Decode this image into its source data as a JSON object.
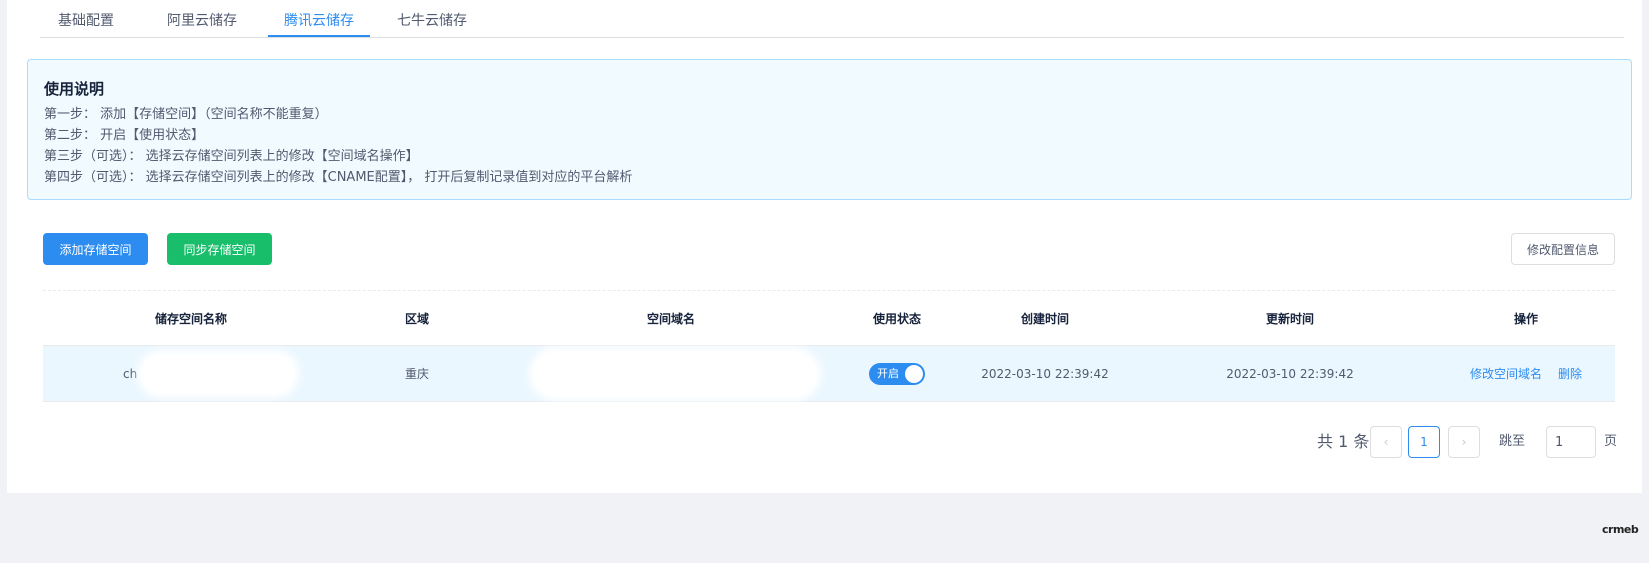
{
  "tabs": [
    {
      "label": "基础配置"
    },
    {
      "label": "阿里云储存"
    },
    {
      "label": "腾讯云储存"
    },
    {
      "label": "七牛云储存"
    }
  ],
  "active_tab": 2,
  "notice": {
    "title": "使用说明",
    "lines": [
      "第一步： 添加【存储空间】（空间名称不能重复）",
      "第二步： 开启【使用状态】",
      "第三步（可选）： 选择云存储空间列表上的修改【空间域名操作】",
      "第四步（可选）： 选择云存储空间列表上的修改【CNAME配置】， 打开后复制记录值到对应的平台解析"
    ]
  },
  "toolbar": {
    "add_label": "添加存储空间",
    "sync_label": "同步存储空间",
    "edit_config_label": "修改配置信息"
  },
  "table": {
    "columns": [
      "储存空间名称",
      "区域",
      "空间域名",
      "使用状态",
      "创建时间",
      "更新时间",
      "操作"
    ],
    "rows": [
      {
        "name": "ch",
        "region": "重庆",
        "domain": "",
        "status_label": "开启",
        "status_on": true,
        "created": "2022-03-10 22:39:42",
        "updated": "2022-03-10 22:39:42",
        "action_edit": "修改空间域名",
        "action_delete": "删除"
      }
    ]
  },
  "pagination": {
    "total_text": "共 1 条",
    "current_page": "1",
    "jump_label": "跳至",
    "jump_value": "1",
    "page_suffix": "页",
    "prev_icon": "chevron-left-icon",
    "next_icon": "chevron-right-icon"
  },
  "brand": {
    "logo_text": "crmeb"
  },
  "colors": {
    "primary": "#2d8cf0",
    "success": "#19be6b",
    "alert_bg": "#f0faff",
    "row_highlight": "#ebf7ff"
  }
}
